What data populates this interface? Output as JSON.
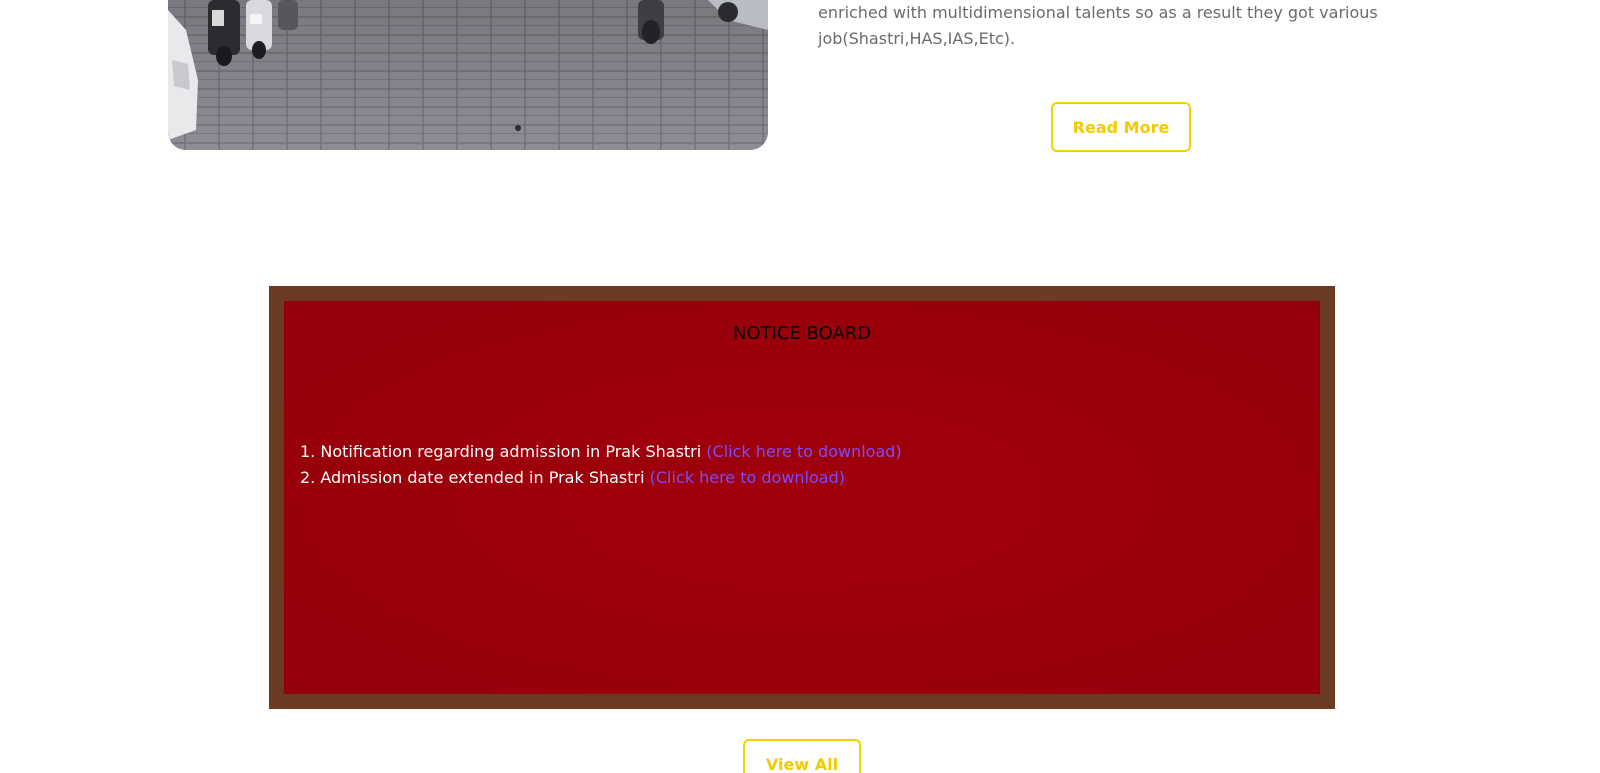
{
  "about": {
    "line1": "enriched with multidimensional talents so as a result they got various",
    "line2": "job(Shastri,HAS,IAS,Etc).",
    "read_more_label": "Read More"
  },
  "photo": {
    "description_icon": "campus-parking-photo"
  },
  "notice_board": {
    "title": "NOTICE BOARD",
    "items": [
      {
        "number": "1.",
        "text": "Notification regarding admission in Prak Shastri",
        "link": "(Click here to download)"
      },
      {
        "number": "2.",
        "text": "Admission date extended in Prak Shastri",
        "link": "(Click here to download)"
      }
    ],
    "view_all_label": "View All"
  },
  "colors": {
    "accent_yellow": "#f5d100",
    "board_frame": "#6b3a23",
    "board_fill": "#9a000a",
    "link": "#7b4bff"
  }
}
